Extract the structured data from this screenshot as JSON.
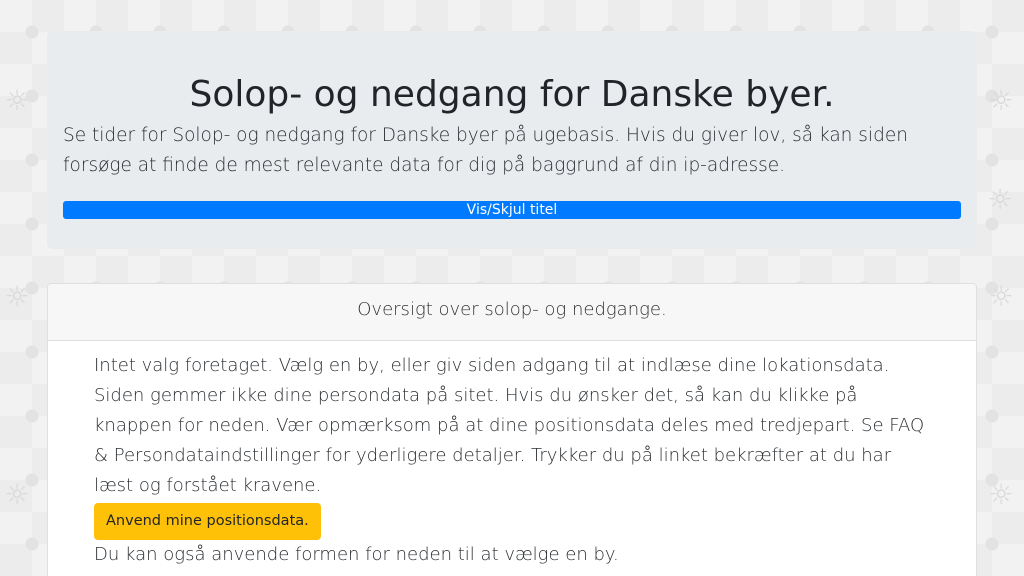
{
  "header": {
    "title": "Solop- og nedgang for Danske byer.",
    "lead": "Se tider for Solop- og nedgang for Danske byer på ugebasis. Hvis du giver lov, så kan siden forsøge at finde de mest relevante data for dig på baggrund af din ip-adresse.",
    "toggle_label": "Vis/Skjul titel"
  },
  "card": {
    "header": "Oversigt over solop- og nedgange.",
    "line1": "Intet valg foretaget. Vælg en by, eller giv siden adgang til at indlæse dine lokationsdata.",
    "line2": "Siden gemmer ikke dine persondata på sitet. Hvis du ønsker det, så kan du klikke på knappen for neden. Vær opmærksom på at dine positionsdata deles med tredjepart. Se FAQ & Persondataindstillinger for yderligere detaljer. Trykker du på linket bekræfter at du har læst og forstået kravene.",
    "button_label": "Anvend mine positionsdata.",
    "line3": "Du kan også anvende formen for neden til at vælge en by."
  },
  "colors": {
    "primary": "#007bff",
    "warning": "#ffc107",
    "jumbotron_bg": "#e9ecef"
  },
  "background_icon": "sun-icon"
}
